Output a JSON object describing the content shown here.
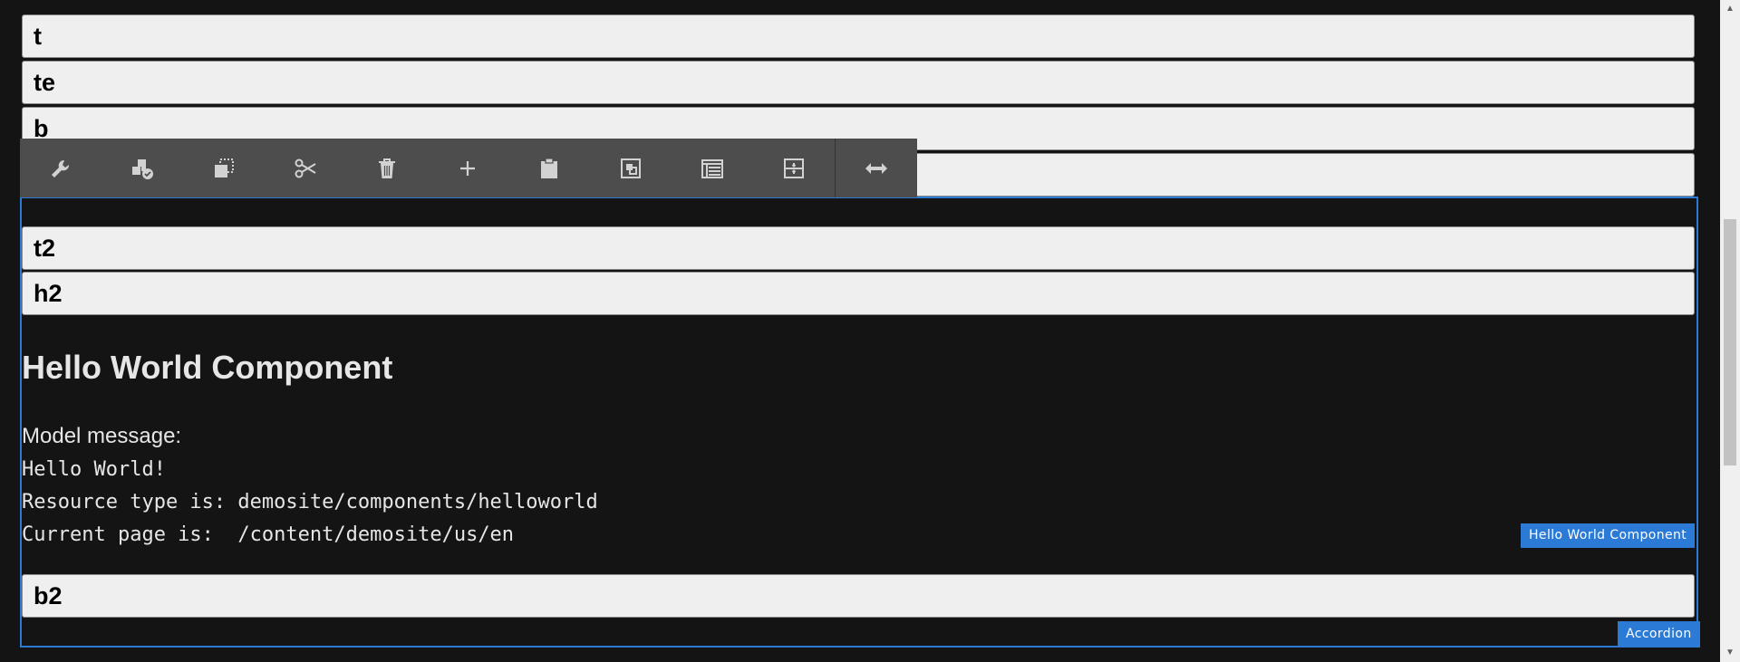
{
  "items": {
    "t": "t",
    "te": "te",
    "b": "b",
    "fourth": "",
    "t2": "t2",
    "h2": "h2",
    "b2": "b2"
  },
  "toolbar": {
    "buttons": [
      {
        "name": "configure",
        "icon": "wrench-icon"
      },
      {
        "name": "policy",
        "icon": "policy-check-icon"
      },
      {
        "name": "copy",
        "icon": "copy-icon"
      },
      {
        "name": "cut",
        "icon": "scissors-icon"
      },
      {
        "name": "delete",
        "icon": "trash-icon"
      },
      {
        "name": "insert",
        "icon": "plus-icon"
      },
      {
        "name": "paste",
        "icon": "clipboard-icon"
      },
      {
        "name": "group",
        "icon": "group-icon"
      },
      {
        "name": "panel-select",
        "icon": "panel-list-icon"
      },
      {
        "name": "layout",
        "icon": "layout-icon"
      },
      {
        "name": "resize",
        "icon": "resize-horizontal-icon"
      }
    ]
  },
  "hello_world": {
    "title": "Hello World Component",
    "model_message_label": "Model message:",
    "message": "Hello World!",
    "resource_type_line": "Resource type is: demosite/components/helloworld",
    "current_page_line": "Current page is:  /content/demosite/us/en"
  },
  "labels": {
    "hello_world_component": "Hello World Component",
    "accordion": "Accordion"
  },
  "colors": {
    "selection": "#2b7ad6",
    "toolbar": "#4d4d4d",
    "background": "#141414"
  }
}
